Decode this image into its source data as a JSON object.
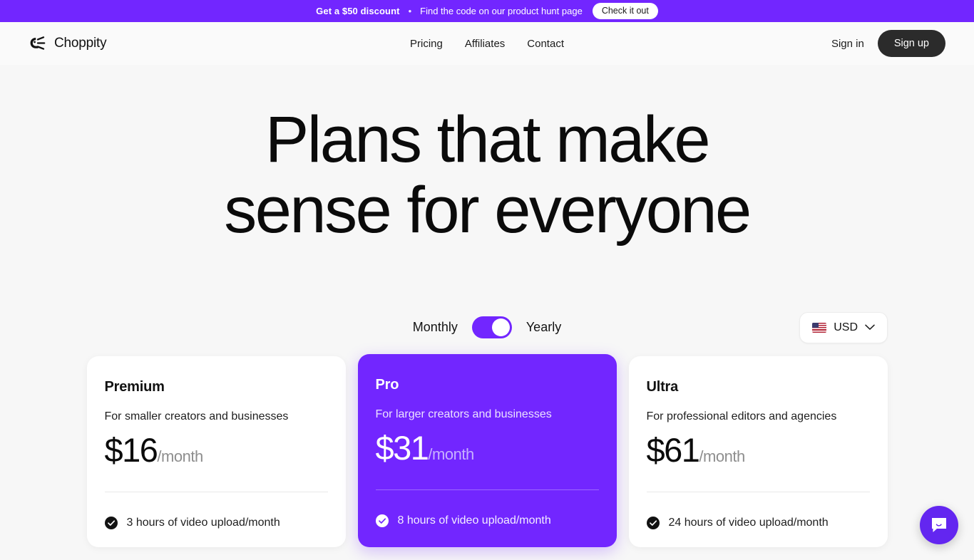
{
  "promo": {
    "strong": "Get a $50 discount",
    "separator": "•",
    "text": "Find the code on our product hunt page",
    "cta_label": "Check it out"
  },
  "nav": {
    "brand_name": "Choppity",
    "brand_icon": "hand-scissors-logo-icon",
    "links": [
      {
        "label": "Pricing"
      },
      {
        "label": "Affiliates"
      },
      {
        "label": "Contact"
      }
    ],
    "signin_label": "Sign in",
    "signup_label": "Sign up"
  },
  "hero": {
    "line1": "Plans that make",
    "line2": "sense for everyone"
  },
  "controls": {
    "monthly_label": "Monthly",
    "yearly_label": "Yearly",
    "toggle_state": "yearly",
    "currency": {
      "flag": "🇺🇸",
      "code": "USD",
      "chevron": "chevron-down-icon"
    }
  },
  "plans": [
    {
      "name": "Premium",
      "description": "For smaller creators and businesses",
      "price": "$16",
      "period": "/month",
      "features": [
        "3 hours of video upload/month"
      ],
      "featured": false
    },
    {
      "name": "Pro",
      "description": "For larger creators and businesses",
      "price": "$31",
      "period": "/month",
      "features": [
        "8 hours of video upload/month"
      ],
      "featured": true
    },
    {
      "name": "Ultra",
      "description": "For professional editors and agencies",
      "price": "$61",
      "period": "/month",
      "features": [
        "24 hours of video upload/month"
      ],
      "featured": false
    }
  ],
  "chat": {
    "icon": "chat-bubble-smile-icon"
  },
  "colors": {
    "brand_purple": "#7226ff",
    "page_background": "#f7f7f7",
    "nav_background": "#fafafa",
    "dark_button": "#2b2b2b",
    "chat_purple": "#6326f0"
  }
}
